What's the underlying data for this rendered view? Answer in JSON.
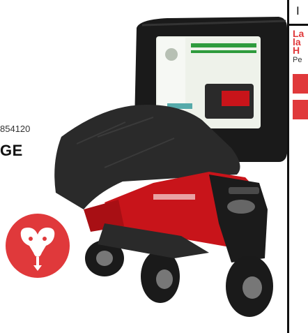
{
  "left_panel": {
    "title_fragment": "GE",
    "code_fragment": "854120"
  },
  "right_column": {
    "top_letter": "I",
    "red_lines": [
      "La",
      "la",
      "H"
    ],
    "sub_text": "Pe"
  },
  "colors": {
    "accent_red": "#e0393b",
    "cover_black": "#1c1c1c",
    "tractor_red": "#c8141a"
  },
  "icons": {
    "badge": "ram-head-icon"
  }
}
